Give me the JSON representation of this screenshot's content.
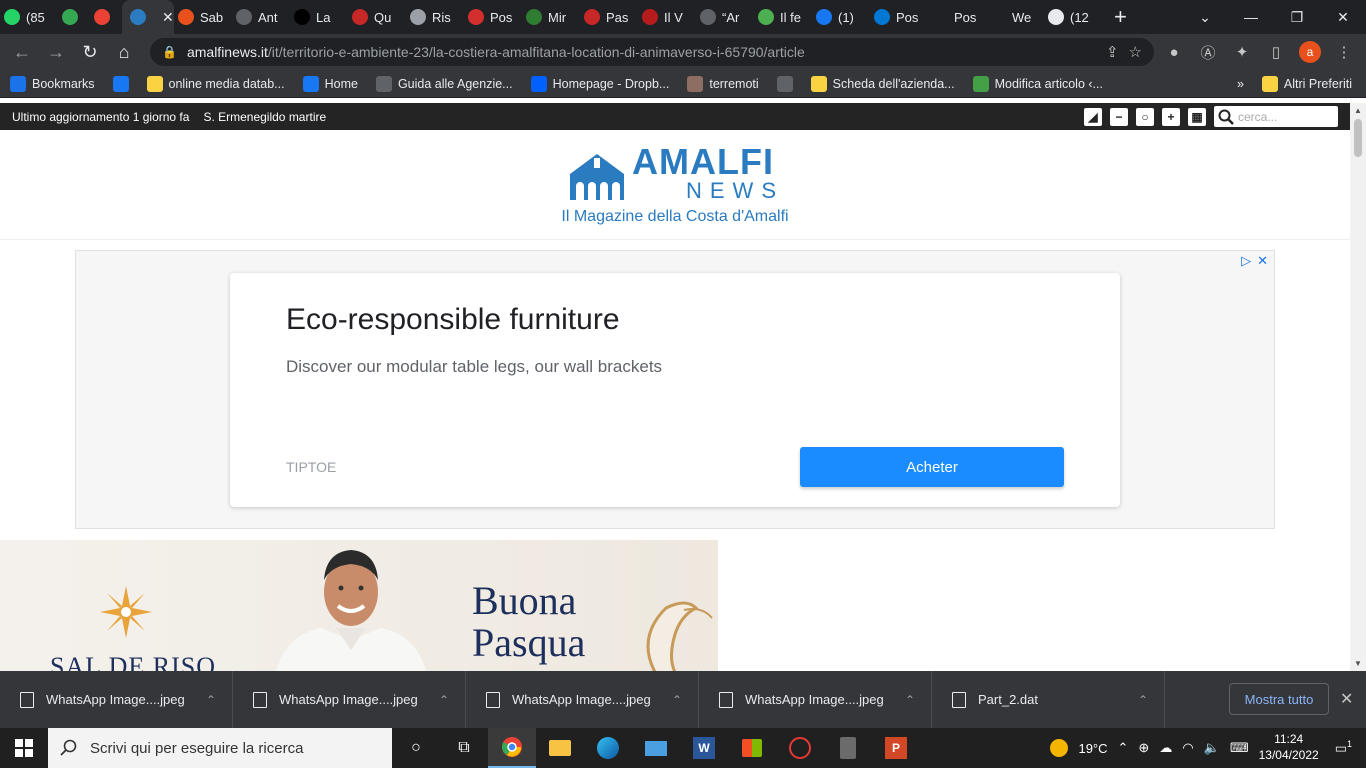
{
  "tabs": [
    {
      "label": "(85",
      "favicon_color": "#25d366",
      "icon": "whatsapp-icon"
    },
    {
      "label": "",
      "favicon_color": "#34a853",
      "icon": "meet-icon"
    },
    {
      "label": "",
      "favicon_color": "#ea4335",
      "icon": "record-icon"
    },
    {
      "label": "",
      "favicon_color": "#2a7bc0",
      "icon": "amalfi-news-icon",
      "active": true
    },
    {
      "label": "Sab",
      "favicon_color": "#e8501c",
      "icon": "vc-icon"
    },
    {
      "label": "Ant",
      "favicon_color": "#5f6368",
      "icon": "globe-icon"
    },
    {
      "label": "La",
      "favicon_color": "#000000",
      "icon": "zon-icon"
    },
    {
      "label": "Qu",
      "favicon_color": "#c62828",
      "icon": "flag-icon"
    },
    {
      "label": "Ris",
      "favicon_color": "#9aa0a6",
      "icon": "quote-icon"
    },
    {
      "label": "Pos",
      "favicon_color": "#d32f2f",
      "icon": "post-icon"
    },
    {
      "label": "Mir",
      "favicon_color": "#2e7d32",
      "icon": "wifi-icon"
    },
    {
      "label": "Pas",
      "favicon_color": "#c62828",
      "icon": "v-icon"
    },
    {
      "label": "Il V",
      "favicon_color": "#b71c1c",
      "icon": "news-icon"
    },
    {
      "label": "“Ar",
      "favicon_color": "#5f6368",
      "icon": "globe-icon"
    },
    {
      "label": "Il fe",
      "favicon_color": "#4caf50",
      "icon": "doc-icon"
    },
    {
      "label": "(1)",
      "favicon_color": "#1877f2",
      "icon": "facebook-icon"
    },
    {
      "label": "Pos",
      "favicon_color": "#0078d4",
      "icon": "outlook-icon"
    },
    {
      "label": "Pos",
      "favicon_color": "#202124",
      "icon": "blank-icon"
    },
    {
      "label": "We",
      "favicon_color": "#202124",
      "icon": "we-icon"
    },
    {
      "label": "(12",
      "favicon_color": "#e8eaed",
      "icon": "chat-icon"
    }
  ],
  "address": {
    "domain": "amalfinews.it",
    "path": "/it/territorio-e-ambiente-23/la-costiera-amalfitana-location-di-animaverso-i-65790/article"
  },
  "profile_initial": "a",
  "bookmarks": [
    {
      "label": "Bookmarks",
      "icon": "star-icon",
      "color": "#1a73e8"
    },
    {
      "label": "",
      "icon": "facebook-icon",
      "color": "#1877f2"
    },
    {
      "label": "online media datab...",
      "icon": "m-icon",
      "color": "#f9d342"
    },
    {
      "label": "Home",
      "icon": "facebook-icon",
      "color": "#1877f2"
    },
    {
      "label": "Guida alle Agenzie...",
      "icon": "film-icon",
      "color": "#5f6368"
    },
    {
      "label": "Homepage - Dropb...",
      "icon": "dropbox-icon",
      "color": "#0061ff"
    },
    {
      "label": "terremoti",
      "icon": "globe-icon",
      "color": "#8d6e63"
    },
    {
      "label": "",
      "icon": "circle-icon",
      "color": "#5f6368"
    },
    {
      "label": "Scheda dell'azienda...",
      "icon": "m-icon",
      "color": "#f9d342"
    },
    {
      "label": "Modifica articolo ‹...",
      "icon": "leaf-icon",
      "color": "#43a047"
    }
  ],
  "bookmarks_more": "»",
  "other_bookmarks": "Altri Preferiti",
  "site": {
    "last_update": "Ultimo aggiornamento 1 giorno fa",
    "saint": "S. Ermenegildo martire",
    "search_placeholder": "cerca...",
    "logo_title": "AMALFI",
    "logo_sub": "NEWS",
    "tagline": "Il Magazine della Costa d'Amalfi",
    "brand_color": "#2a7bc0"
  },
  "ad": {
    "title": "Eco-responsible furniture",
    "subtitle": "Discover our modular table legs, our wall brackets",
    "brand": "TIPTOE",
    "cta": "Acheter"
  },
  "banner": {
    "brand": "SAL DE RISO",
    "greeting_line1": "Buona",
    "greeting_line2": "Pasqua"
  },
  "downloads": [
    {
      "name": "WhatsApp Image....jpeg"
    },
    {
      "name": "WhatsApp Image....jpeg"
    },
    {
      "name": "WhatsApp Image....jpeg"
    },
    {
      "name": "WhatsApp Image....jpeg"
    },
    {
      "name": "Part_2.dat"
    }
  ],
  "show_all": "Mostra tutto",
  "taskbar": {
    "search_placeholder": "Scrivi qui per eseguire la ricerca",
    "temperature": "19°C",
    "time": "11:24",
    "date": "13/04/2022",
    "notifications": "1"
  }
}
